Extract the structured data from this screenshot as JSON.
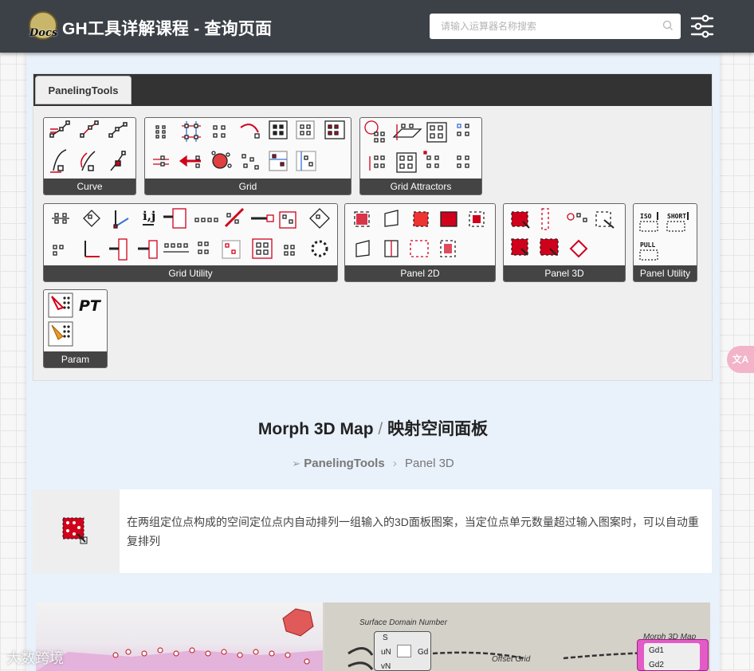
{
  "header": {
    "logo_text": "Docs",
    "title": "GH工具详解课程 - 查询页面",
    "search_placeholder": "请输入运算器名称搜索"
  },
  "panel": {
    "tab_label": "PanelingTools",
    "groups": [
      {
        "id": "curve",
        "label": "Curve"
      },
      {
        "id": "grid",
        "label": "Grid"
      },
      {
        "id": "grid-attractors",
        "label": "Grid Attractors"
      },
      {
        "id": "grid-utility",
        "label": "Grid Utility"
      },
      {
        "id": "panel-2d",
        "label": "Panel 2D"
      },
      {
        "id": "panel-3d",
        "label": "Panel 3D"
      },
      {
        "id": "panel-utility",
        "label": "Panel Utility"
      },
      {
        "id": "param",
        "label": "Param"
      }
    ],
    "panel_utility_icons": [
      "ISO",
      "SHORT",
      "PULL"
    ],
    "param_text": "PT",
    "grid_utility_ij": "i,j"
  },
  "page": {
    "title_en": "Morph 3D Map",
    "title_sep": "/",
    "title_cn": "映射空间面板",
    "breadcrumb_root": "PanelingTools",
    "breadcrumb_child": "Panel 3D",
    "description": "在两组定位点构成的空间定位点内自动排列一组输入的3D面板图案，当定位点单元数量超过输入图案时，可以自动重复排列"
  },
  "preview": {
    "label_surface_domain": "Surface Domain Number",
    "node_inputs": [
      "S",
      "uN",
      "vN"
    ],
    "node_output": "Gd",
    "label_offset_grid": "Offset Grid",
    "label_morph": "Morph 3D Map",
    "morph_inputs": [
      "Gd1",
      "Gd2"
    ]
  },
  "overlay": {
    "watermark": "大数跨境",
    "translate_label": "文A"
  },
  "colors": {
    "header_bg": "#3c4047",
    "main_bg": "#e9f1fb",
    "accent_red": "#d0021b"
  }
}
